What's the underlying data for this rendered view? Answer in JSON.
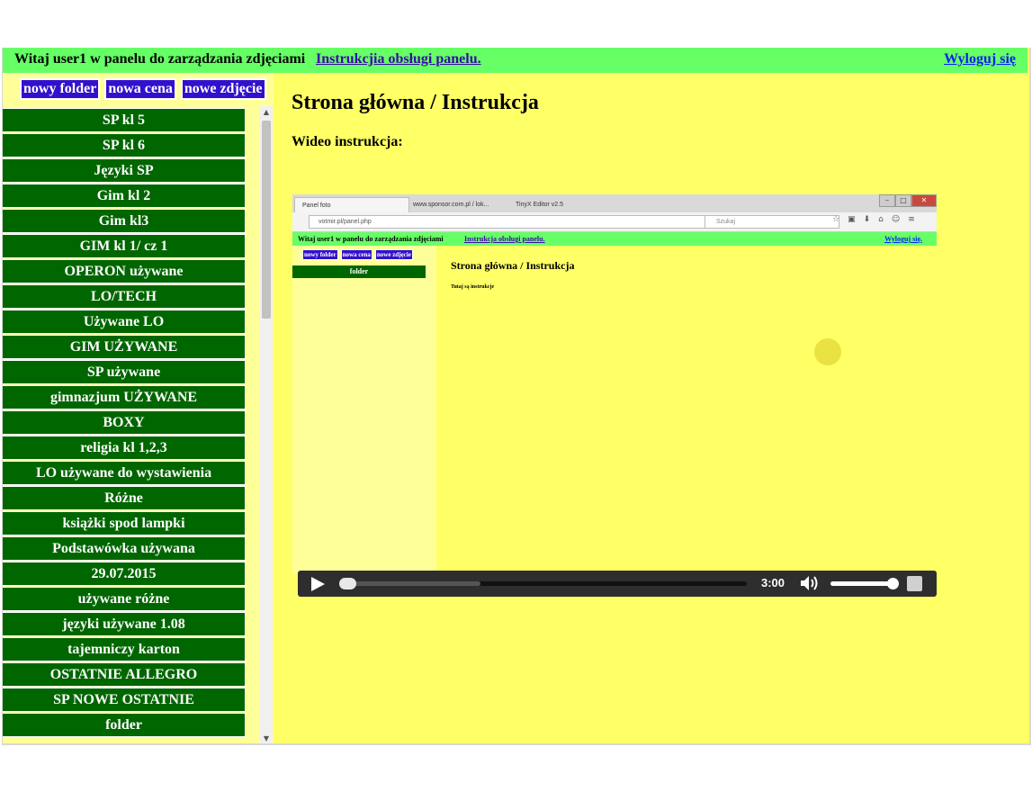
{
  "header": {
    "welcome": "Witaj user1 w panelu do zarządzania zdjęciami",
    "help_link": "Instrukcjia obsługi panelu.",
    "logout": "Wyloguj się"
  },
  "actions": [
    "nowy folder",
    "nowa cena",
    "nowe zdjęcie"
  ],
  "folders": [
    "SP kl 5",
    "SP kl 6",
    "Języki SP",
    "Gim kl 2",
    "Gim kl3",
    "GIM kl 1/ cz 1",
    "OPERON używane",
    "LO/TECH",
    "Używane LO",
    "GIM UŻYWANE",
    "SP używane",
    "gimnazjum UŻYWANE",
    "BOXY",
    "religia kl 1,2,3",
    "LO używane do wystawienia",
    "Różne",
    "książki spod lampki",
    "Podstawówka używana",
    "29.07.2015",
    "używane różne",
    "języki używane 1.08",
    "tajemniczy karton",
    "OSTATNIE ALLEGRO",
    "SP NOWE OSTATNIE",
    "folder"
  ],
  "main": {
    "title": "Strona główna / Instrukcja",
    "video_label": "Wideo instrukcja:"
  },
  "video": {
    "time": "3:00",
    "progress": 0.0,
    "buffered": 0.34,
    "volume": 0.95,
    "frame": {
      "tabs": [
        "Panel foto",
        "www.sponsor.com.pl / lok...",
        "TinyX Editor v2.5"
      ],
      "url": "votmir.pl/panel.php",
      "search_placeholder": "Szukaj",
      "welcome": "Witaj user1 w panelu do zarządzania zdjęciami",
      "help_link": "Instrukcja obsługi panelu.",
      "logout": "Wyloguj się.",
      "actions": [
        "nowy folder",
        "nowa cena",
        "nowe zdjęcie"
      ],
      "folder": "folder",
      "title": "Strona główna / Instrukcja",
      "text": "Tutaj są instrukcje"
    }
  },
  "colors": {
    "page_bg": "#ffff66",
    "topbar": "#66ff66",
    "sidebar_bg": "#ffff99",
    "folder_bg": "#006600",
    "button_bg": "#3311cc",
    "link": "#3a0aa8"
  }
}
